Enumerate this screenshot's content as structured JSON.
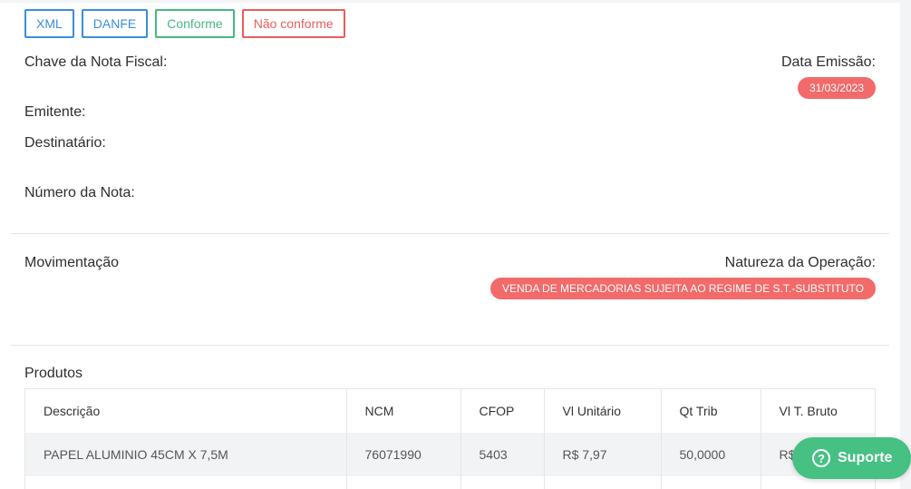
{
  "actions": {
    "xml": "XML",
    "danfe": "DANFE",
    "conforme": "Conforme",
    "nao_conforme": "Não conforme"
  },
  "nota": {
    "chave_label": "Chave da Nota Fiscal:",
    "data_emissao_label": "Data Emissão:",
    "data_emissao_value": "31/03/2023",
    "emitente_label": "Emitente:",
    "destinatario_label": "Destinatário:",
    "numero_label": "Número da Nota:"
  },
  "movimentacao": {
    "title": "Movimentação",
    "natureza_label": "Natureza da Operação:",
    "natureza_value": "VENDA DE MERCADORIAS SUJEITA AO REGIME DE S.T.-SUBSTITUTO"
  },
  "produtos": {
    "title": "Produtos",
    "columns": [
      "Descrição",
      "NCM",
      "CFOP",
      "Vl Unitário",
      "Qt Trib",
      "Vl T. Bruto"
    ],
    "rows": [
      [
        "PAPEL ALUMINIO 45CM X 7,5M",
        "76071990",
        "5403",
        "R$ 7,97",
        "50,0000",
        "R$"
      ]
    ]
  },
  "support": {
    "label": "Suporte",
    "icon": "question-circle-icon"
  },
  "colors": {
    "blue": "#3b8dde",
    "green": "#46b883",
    "red": "#ea5c5c",
    "pill": "#f26a6a",
    "support": "#46c083"
  }
}
